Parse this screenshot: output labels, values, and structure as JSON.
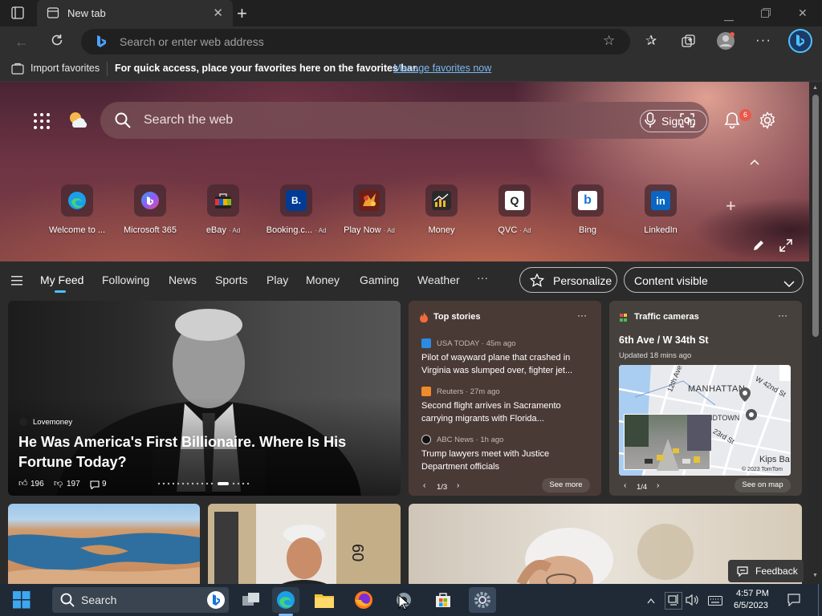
{
  "browser": {
    "tab_title": "New tab",
    "address_placeholder": "Search or enter web address",
    "favorites_bar": {
      "import_label": "Import favorites",
      "message": "For quick access, place your favorites here on the favorites bar.",
      "manage_link": "Manage favorites now"
    }
  },
  "newtab": {
    "search_placeholder": "Search the web",
    "sign_in_label": "Sign in",
    "notification_count": "6",
    "quick_links": [
      {
        "label": "Welcome to ...",
        "ad": "",
        "icon": "edge-icon"
      },
      {
        "label": "Microsoft 365",
        "ad": "",
        "icon": "microsoft365-icon"
      },
      {
        "label": "eBay",
        "ad": "· Ad",
        "icon": "ebay-icon"
      },
      {
        "label": "Booking.c...",
        "ad": "· Ad",
        "icon": "booking-icon"
      },
      {
        "label": "Play Now",
        "ad": "· Ad",
        "icon": "play-now-icon"
      },
      {
        "label": "Money",
        "ad": "",
        "icon": "money-icon"
      },
      {
        "label": "QVC",
        "ad": "· Ad",
        "icon": "qvc-icon"
      },
      {
        "label": "Bing",
        "ad": "",
        "icon": "bing-icon"
      },
      {
        "label": "LinkedIn",
        "ad": "",
        "icon": "linkedin-icon"
      }
    ],
    "qvc_letter": "Q",
    "booking_letter": "B.",
    "bing_letter": "b",
    "linkedin_letter": "in",
    "feed_tabs": [
      "My Feed",
      "Following",
      "News",
      "Sports",
      "Play",
      "Money",
      "Gaming",
      "Weather"
    ],
    "active_tab": "My Feed",
    "more_tabs": "···",
    "personalize_label": "Personalize",
    "content_visible_label": "Content visible"
  },
  "hero_story": {
    "source": "Lovemoney",
    "headline": "He Was America's First Billionaire. Where Is His Fortune Today?",
    "likes": "196",
    "dislikes": "197",
    "comments": "9"
  },
  "top_stories": {
    "title": "Top stories",
    "items": [
      {
        "source": "USA TODAY · 45m ago",
        "headline": "Pilot of wayward plane that crashed in Virginia was slumped over, fighter jet..."
      },
      {
        "source": "Reuters · 27m ago",
        "headline": "Second flight arrives in Sacramento carrying migrants with Florida..."
      },
      {
        "source": "ABC News · 1h ago",
        "headline": "Trump lawyers meet with Justice Department officials"
      }
    ],
    "pager": "1/3",
    "see_more": "See more"
  },
  "traffic": {
    "title": "Traffic cameras",
    "location": "6th Ave / W 34th St",
    "updated": "Updated 18 mins ago",
    "map_labels": {
      "area": "MANHATTAN",
      "street1": "12th Ave",
      "street2": "W 42nd St",
      "street3": "23rd St",
      "district": "IDTOWN",
      "place": "Kips Ba",
      "copyright": "© 2023 TomTom"
    },
    "pager": "1/4",
    "see_on_map": "See on map"
  },
  "feedback_label": "Feedback",
  "taskbar": {
    "search_label": "Search",
    "time": "4:57 PM",
    "date": "6/5/2023"
  },
  "colors": {
    "accent": "#4cc2ff",
    "link": "#7db7f0",
    "badge": "#e8594a",
    "taskbar": "#1f2a36"
  }
}
